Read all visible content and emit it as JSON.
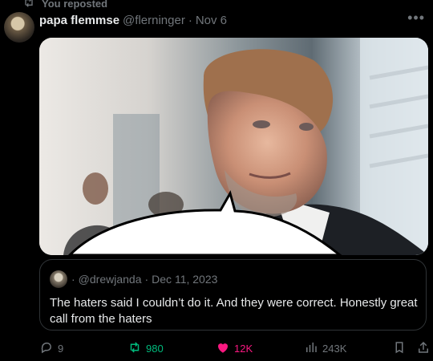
{
  "repost_label": "You reposted",
  "author": {
    "name": "papa flemmse",
    "handle": "@flerninger",
    "separator": "·",
    "date": "Nov 6"
  },
  "quoted": {
    "handle": "@drewjanda",
    "separator": "·",
    "date": "Dec 11, 2023",
    "text": "The haters said I couldn’t do it. And they were correct. Honestly great call from the haters"
  },
  "counts": {
    "replies": "9",
    "reposts": "980",
    "likes": "12K",
    "views": "243K"
  },
  "icons": {
    "more": "ellipsis-icon",
    "reply": "comment-icon",
    "repost": "repost-icon",
    "like": "heart-icon",
    "views": "bar-chart-icon",
    "bookmark": "bookmark-icon",
    "share": "share-icon"
  },
  "colors": {
    "background": "#000000",
    "text": "#e7e9ea",
    "muted": "#71767b",
    "repost": "#00ba7c",
    "like": "#f91880"
  }
}
